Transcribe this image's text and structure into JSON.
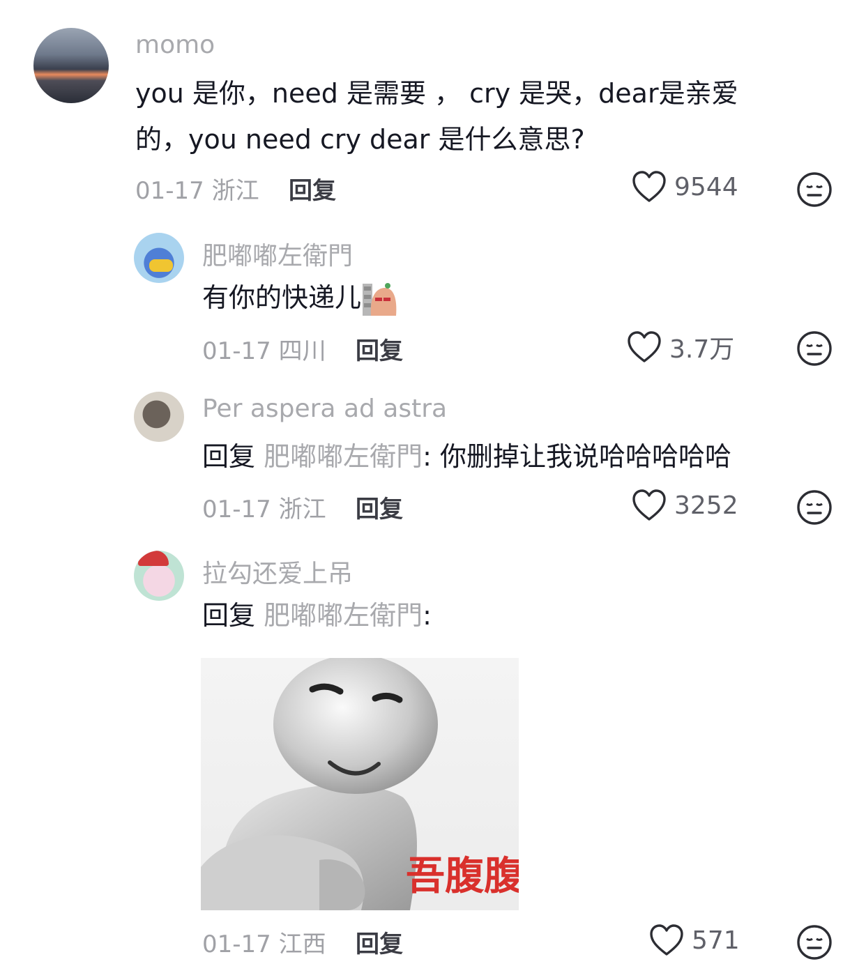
{
  "comments": [
    {
      "username": "momo",
      "text_line1": "you 是你，need 是需要 ， cry 是哭，dear是亲爱",
      "text_line2": "的，you need cry dear 是什么意思?",
      "date_region": "01-17 浙江",
      "reply_label": "回复",
      "likes": "9544"
    },
    {
      "username": "肥嘟嘟左衛門",
      "text": "有你的快递儿",
      "date_region": "01-17 四川",
      "reply_label": "回复",
      "likes": "3.7万"
    },
    {
      "username": "Per aspera ad astra",
      "reply_prefix": "回复",
      "reply_target": "肥嘟嘟左衛門",
      "text": ": 你删掉让我说哈哈哈哈哈",
      "date_region": "01-17 浙江",
      "reply_label": "回复",
      "likes": "3252"
    },
    {
      "username": "拉勾还爱上吊",
      "reply_prefix": "回复",
      "reply_target": "肥嘟嘟左衛門",
      "text": ":",
      "sticker_caption": "吾腹腹",
      "date_region": "01-17 江西",
      "reply_label": "回复",
      "likes": "571"
    }
  ],
  "icons": {
    "like": "heart-outline-icon",
    "dislike": "neutral-face-icon"
  },
  "colors": {
    "meta_gray": "#a0a1a6",
    "text_dark": "#161823",
    "sticker_red": "#d9302c"
  }
}
